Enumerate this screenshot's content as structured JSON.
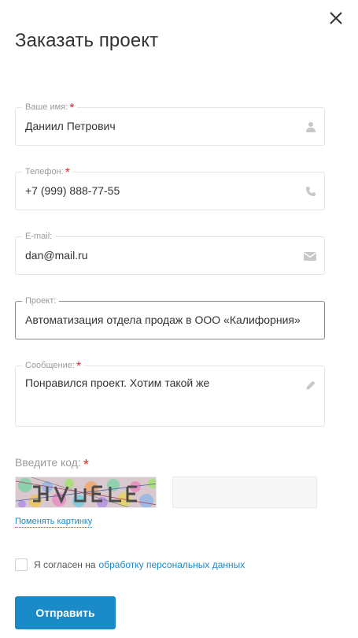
{
  "modal": {
    "title": "Заказать проект"
  },
  "fields": {
    "name": {
      "label": "Ваше имя:",
      "required": "*",
      "value": "Даниил Петрович",
      "icon": "user-icon"
    },
    "phone": {
      "label": "Телефон:",
      "required": "*",
      "value": "+7 (999) 888-77-55",
      "icon": "phone-icon"
    },
    "email": {
      "label": "E-mail:",
      "value": "dan@mail.ru",
      "icon": "envelope-icon"
    },
    "project": {
      "label": "Проект:",
      "value": "Автоматизация отдела продаж в ООО «Калифорния»"
    },
    "message": {
      "label": "Сообщение:",
      "required": "*",
      "value": "Понравился проект. Хотим такой же",
      "icon": "pencil-icon"
    }
  },
  "captcha": {
    "label": "Введите код:",
    "required": "*",
    "input_value": "",
    "change_link": "Поменять картинку"
  },
  "agreement": {
    "text": "Я согласен на",
    "link": "обработку персональных данных",
    "checked": false
  },
  "submit": {
    "label": "Отправить"
  },
  "colors": {
    "accent": "#1a8ac9",
    "required": "#d92a2a",
    "label": "#9a9a9a",
    "border": "#e6e6e6"
  }
}
